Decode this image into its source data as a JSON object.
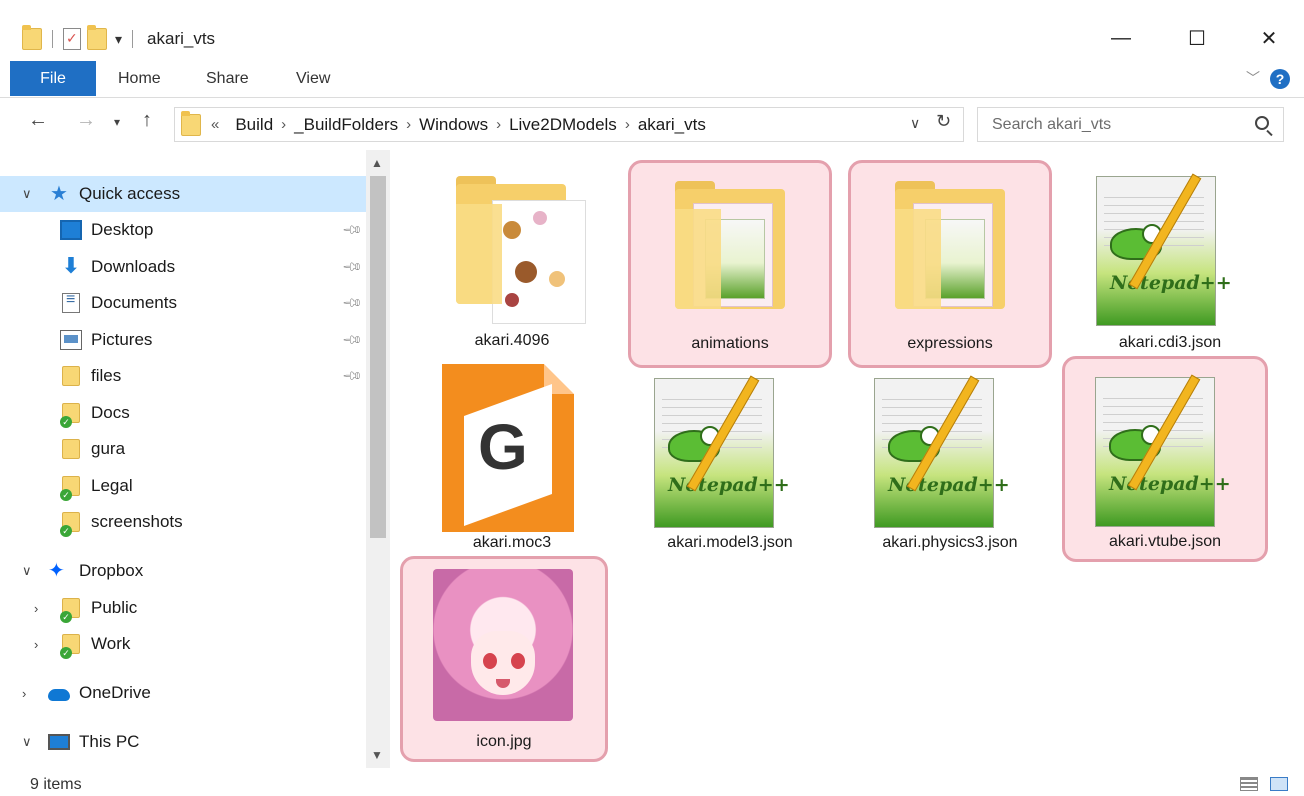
{
  "window": {
    "title": "akari_vts",
    "minimize_glyph": "—",
    "maximize_glyph": "☐",
    "close_glyph": "✕"
  },
  "ribbon": {
    "file": "File",
    "tabs": [
      "Home",
      "Share",
      "View"
    ],
    "help_glyph": "?"
  },
  "address": {
    "prefix": "«",
    "crumbs": [
      "Build",
      "_BuildFolders",
      "Windows",
      "Live2DModels",
      "akari_vts"
    ],
    "separator": "›"
  },
  "search": {
    "placeholder": "Search akari_vts"
  },
  "nav": {
    "quick_access": "Quick access",
    "items": [
      {
        "label": "Desktop",
        "icon": "desktop-icon"
      },
      {
        "label": "Downloads",
        "icon": "download-icon"
      },
      {
        "label": "Documents",
        "icon": "documents-icon"
      },
      {
        "label": "Pictures",
        "icon": "pictures-icon"
      },
      {
        "label": "files",
        "icon": "folder-icon"
      },
      {
        "label": "Docs",
        "icon": "synced-folder-icon"
      },
      {
        "label": "gura",
        "icon": "folder-icon"
      },
      {
        "label": "Legal",
        "icon": "synced-folder-icon"
      },
      {
        "label": "screenshots",
        "icon": "synced-folder-icon"
      }
    ],
    "dropbox": "Dropbox",
    "dropbox_children": [
      "Public",
      "Work"
    ],
    "onedrive": "OneDrive",
    "thispc": "This PC"
  },
  "files": [
    {
      "name": "akari.4096",
      "type": "image-folder",
      "highlighted": false
    },
    {
      "name": "animations",
      "type": "folder",
      "highlighted": true
    },
    {
      "name": "expressions",
      "type": "folder",
      "highlighted": true
    },
    {
      "name": "akari.cdi3.json",
      "type": "notepad-file",
      "highlighted": false
    },
    {
      "name": "akari.moc3",
      "type": "moc3-file",
      "highlighted": false
    },
    {
      "name": "akari.model3.json",
      "type": "notepad-file",
      "highlighted": false
    },
    {
      "name": "akari.physics3.json",
      "type": "notepad-file",
      "highlighted": false
    },
    {
      "name": "akari.vtube.json",
      "type": "notepad-file",
      "highlighted": true
    },
    {
      "name": "icon.jpg",
      "type": "image-file",
      "highlighted": true
    }
  ],
  "notepad_brand": "Notepad++",
  "moc_glyph": "G",
  "status": {
    "count": "9 items"
  },
  "colors": {
    "file_tab": "#1f6fc4",
    "selection": "#cce8ff",
    "highlight_fill": "#fde2e6",
    "highlight_border": "#e4a0ad"
  }
}
